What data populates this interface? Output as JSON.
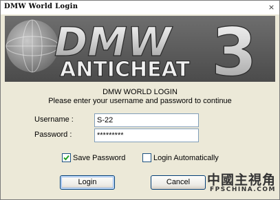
{
  "window": {
    "title": "DMW World Login",
    "close_glyph": "×"
  },
  "banner": {
    "logo_dmw": "DMW",
    "logo_anticheat": "ANTICHEAT",
    "logo_number": "3",
    "globe_icon": "globe-icon"
  },
  "dialog": {
    "heading": "DMW WORLD LOGIN",
    "subheading": "Please enter your username and password to continue",
    "username_label": "Username :",
    "username_value": "S-22",
    "password_label": "Password :",
    "password_value": "*********",
    "save_password_label": "Save Password",
    "save_password_checked": true,
    "login_auto_label": "Login Automatically",
    "login_auto_checked": false,
    "login_button": "Login",
    "cancel_button": "Cancel"
  },
  "watermark": {
    "chinese": "中國主視角",
    "site": "FPSCHINA.COM"
  },
  "colors": {
    "banner_bg": "#555555",
    "logo_silver": "#e8e8e8",
    "dialog_bg": "#ece9d8",
    "checkbox_border": "#1c5180",
    "watermark_text": "#333333"
  }
}
